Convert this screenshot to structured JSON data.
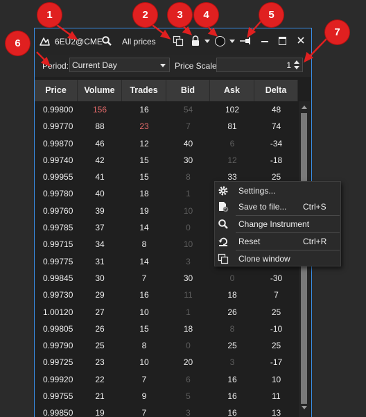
{
  "titlebar": {
    "instrument": "6EU2@CME",
    "mode": "All prices",
    "icons": [
      "logo-icon",
      "search-icon",
      "clone-icon",
      "lock-icon",
      "chevron-down-icon",
      "circle-icon",
      "pin-icon",
      "minimize-icon",
      "maximize-icon",
      "close-icon"
    ]
  },
  "toolbar": {
    "period_label": "Period:",
    "period_value": "Current Day",
    "price_scale_label": "Price Scale:",
    "price_scale_value": "1"
  },
  "table": {
    "columns": [
      "Price",
      "Volume",
      "Trades",
      "Bid",
      "Ask",
      "Delta"
    ],
    "rows": [
      [
        "0.99800",
        "156",
        "16",
        "54",
        "102",
        "48"
      ],
      [
        "0.99770",
        "88",
        "23",
        "7",
        "81",
        "74"
      ],
      [
        "0.99870",
        "46",
        "12",
        "40",
        "6",
        "-34"
      ],
      [
        "0.99740",
        "42",
        "15",
        "30",
        "12",
        "-18"
      ],
      [
        "0.99955",
        "41",
        "15",
        "8",
        "33",
        "25"
      ],
      [
        "0.99780",
        "40",
        "18",
        "1",
        "",
        ""
      ],
      [
        "0.99760",
        "39",
        "19",
        "10",
        "",
        ""
      ],
      [
        "0.99785",
        "37",
        "14",
        "0",
        "",
        ""
      ],
      [
        "0.99715",
        "34",
        "8",
        "10",
        "",
        ""
      ],
      [
        "0.99775",
        "31",
        "14",
        "3",
        "",
        ""
      ],
      [
        "0.99845",
        "30",
        "7",
        "30",
        "0",
        "-30"
      ],
      [
        "0.99730",
        "29",
        "16",
        "11",
        "18",
        "7"
      ],
      [
        "1.00120",
        "27",
        "10",
        "1",
        "26",
        "25"
      ],
      [
        "0.99805",
        "26",
        "15",
        "18",
        "8",
        "-10"
      ],
      [
        "0.99790",
        "25",
        "8",
        "0",
        "25",
        "25"
      ],
      [
        "0.99725",
        "23",
        "10",
        "20",
        "3",
        "-17"
      ],
      [
        "0.99920",
        "22",
        "7",
        "6",
        "16",
        "10"
      ],
      [
        "0.99755",
        "21",
        "9",
        "5",
        "16",
        "11"
      ],
      [
        "0.99850",
        "19",
        "7",
        "3",
        "16",
        "13"
      ]
    ],
    "styles": [
      [
        "",
        "red",
        "",
        "dim",
        "",
        ""
      ],
      [
        "",
        "",
        "red",
        "dim",
        "",
        ""
      ],
      [
        "",
        "",
        "",
        "",
        "dim",
        ""
      ],
      [
        "",
        "",
        "",
        "",
        "dim",
        ""
      ],
      [
        "",
        "",
        "",
        "dim",
        "",
        ""
      ],
      [
        "",
        "",
        "",
        "dim",
        "",
        ""
      ],
      [
        "",
        "",
        "",
        "dim",
        "",
        ""
      ],
      [
        "",
        "",
        "",
        "dim",
        "",
        ""
      ],
      [
        "",
        "",
        "",
        "dim",
        "",
        ""
      ],
      [
        "",
        "",
        "",
        "dim",
        "",
        ""
      ],
      [
        "",
        "",
        "",
        "",
        "dim",
        ""
      ],
      [
        "",
        "",
        "",
        "dim",
        "",
        ""
      ],
      [
        "",
        "",
        "",
        "dim",
        "",
        ""
      ],
      [
        "",
        "",
        "",
        "",
        "dim",
        ""
      ],
      [
        "",
        "",
        "",
        "dim",
        "",
        ""
      ],
      [
        "",
        "",
        "",
        "",
        "dim",
        ""
      ],
      [
        "",
        "",
        "",
        "dim",
        "",
        ""
      ],
      [
        "",
        "",
        "",
        "dim",
        "",
        ""
      ],
      [
        "",
        "",
        "",
        "dim",
        "",
        ""
      ]
    ]
  },
  "context_menu": {
    "items": [
      {
        "label": "Settings...",
        "shortcut": "",
        "icon": "gear-icon"
      },
      {
        "label": "Save to file...",
        "shortcut": "Ctrl+S",
        "icon": "save-file-icon"
      },
      {
        "label": "Change Instrument",
        "shortcut": "",
        "icon": "search-icon"
      },
      {
        "label": "Reset",
        "shortcut": "Ctrl+R",
        "icon": "reset-icon"
      },
      {
        "label": "Clone window",
        "shortcut": "",
        "icon": "clone-icon"
      }
    ]
  },
  "callouts": [
    "1",
    "2",
    "3",
    "4",
    "5",
    "6",
    "7"
  ],
  "colors": {
    "accent_border": "#3a8ee6",
    "callout_red": "#e02020",
    "negative_value_red": "#e46a6a",
    "background": "#1f1f1f"
  }
}
